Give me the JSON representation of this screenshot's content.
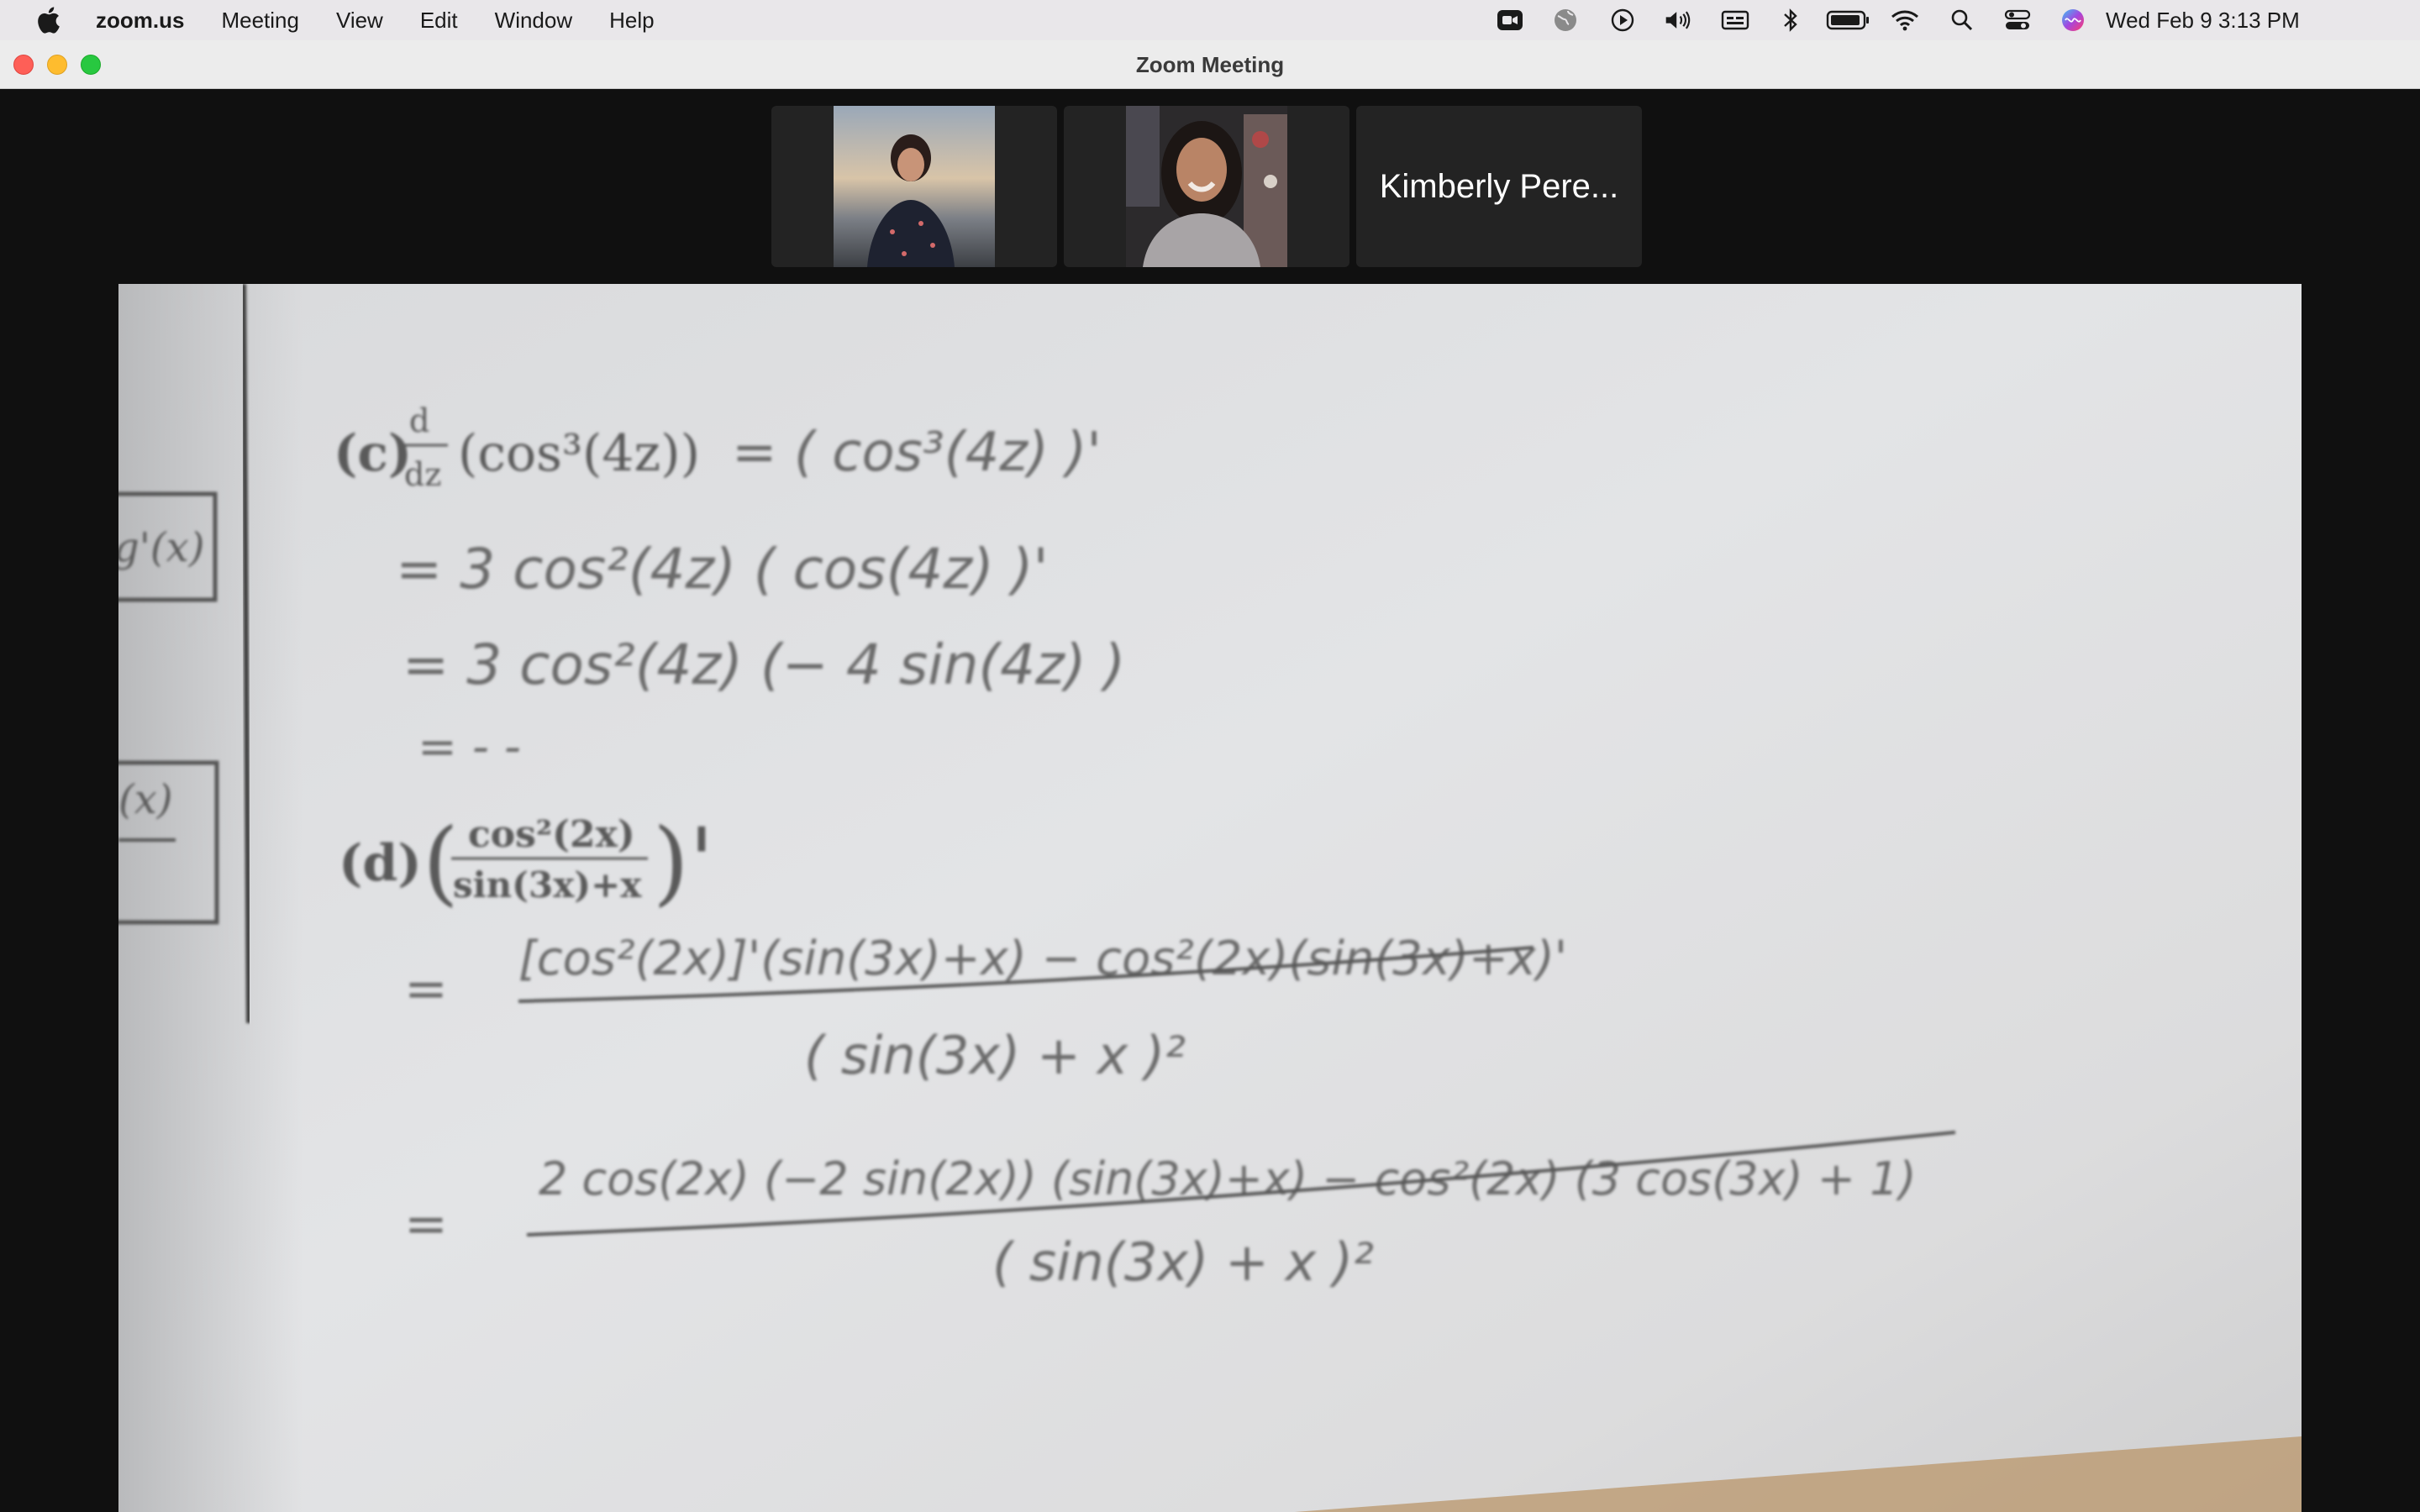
{
  "menubar": {
    "app_name": "zoom.us",
    "menus": [
      "Meeting",
      "View",
      "Edit",
      "Window",
      "Help"
    ],
    "clock": "Wed Feb 9  3:13 PM",
    "status_icons": [
      "zoom-video-icon",
      "globe-icon",
      "play-icon",
      "volume-icon",
      "caption-icon",
      "bluetooth-icon",
      "battery-icon",
      "wifi-icon",
      "spotlight-search-icon",
      "control-center-icon",
      "siri-icon"
    ]
  },
  "window": {
    "title": "Zoom Meeting"
  },
  "participants": {
    "third_name": "Kimberly Pere..."
  },
  "shared_content": {
    "problem_c_label": "(c)",
    "problem_c_expr": "(cos³(4z))",
    "problem_c_d": "d",
    "problem_c_dz": "dz",
    "problem_c_line1": "= ( cos³(4z) )'",
    "problem_c_line2": "= 3 cos²(4z) ( cos(4z) )'",
    "problem_c_line3": "= 3 cos²(4z) (− 4 sin(4z) )",
    "problem_c_line4": "= - -",
    "problem_d_label": "(d)",
    "problem_d_num": "cos²(2x)",
    "problem_d_den": "sin(3x)+x",
    "problem_d_line1_num": "[cos²(2x)]'(sin(3x)+x) − cos²(2x)(sin(3x)+x)'",
    "problem_d_line1_den": "( sin(3x) + x )²",
    "problem_d_line2_num": "2 cos(2x) (−2 sin(2x)) (sin(3x)+x) − cos²(2x) (3 cos(3x) + 1)",
    "problem_d_line2_den": "( sin(3x) + x )²",
    "margin_box_1": "g'(x)",
    "margin_box_2": "(x)",
    "eq_sign": "="
  }
}
